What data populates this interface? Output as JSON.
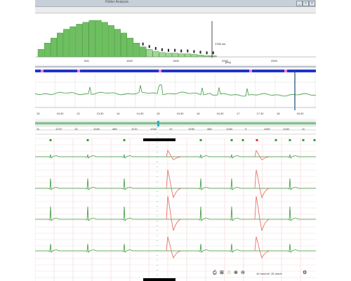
{
  "window": {
    "title": "Holter Analysis",
    "buttons": [
      "_",
      "□",
      "×"
    ]
  },
  "histogram": {
    "cursor_label": "1750 ms",
    "unit_label": "[ms]",
    "x_ticks": [
      "500",
      "1000",
      "1500",
      "2000",
      "2500"
    ],
    "bar_values": [
      12,
      22,
      30,
      38,
      44,
      48,
      52,
      55,
      58,
      58,
      55,
      50,
      44,
      38,
      30,
      22,
      16,
      12,
      9,
      7,
      6,
      6,
      5,
      5,
      4,
      3,
      2,
      2
    ]
  },
  "trend": {
    "time_ticks": [
      "15",
      "15.30",
      "13",
      "13.30",
      "14",
      "14.30",
      "15",
      "15.30",
      "16",
      "16.30",
      "17",
      "17.30",
      "18",
      "18.30"
    ]
  },
  "strip": {
    "top_ticks": [
      "11",
      "1270",
      "13",
      "1240",
      "480",
      "1170",
      "1240",
      "12",
      "1230",
      "480",
      "1240",
      "3",
      "1190",
      "1240",
      "11"
    ],
    "second_ticks": [
      "N",
      "N",
      "N",
      "N",
      "V",
      "N",
      "N",
      "N",
      "V",
      "N",
      "N",
      "N",
      "N"
    ],
    "beat_markers": [
      {
        "label": "N",
        "color": "#2f9e44"
      },
      {
        "label": "N",
        "color": "#2f9e44"
      },
      {
        "label": "N",
        "color": "#2f9e44"
      },
      {
        "label": "N",
        "color": "#2f9e44"
      },
      {
        "label": "V",
        "color": "#e03131"
      },
      {
        "label": "N",
        "color": "#2f9e44"
      },
      {
        "label": "N",
        "color": "#2f9e44"
      },
      {
        "label": "N",
        "color": "#2f9e44"
      },
      {
        "label": "V",
        "color": "#e03131"
      },
      {
        "label": "N",
        "color": "#2f9e44"
      },
      {
        "label": "N",
        "color": "#2f9e44"
      },
      {
        "label": "N",
        "color": "#2f9e44"
      },
      {
        "label": "N",
        "color": "#2f9e44"
      }
    ]
  },
  "status": {
    "speed_label": "10 mm/mV, 25 mm/s"
  },
  "icons": [
    "print-icon",
    "ruler-icon",
    "warning-icon",
    "zoom-in-icon",
    "zoom-out-icon",
    "settings-icon"
  ],
  "colors": {
    "normal": "#3a9a3e",
    "ventricular": "#e8736a",
    "grid": "#f2d6d6",
    "histogram": "#6dbf5f"
  }
}
